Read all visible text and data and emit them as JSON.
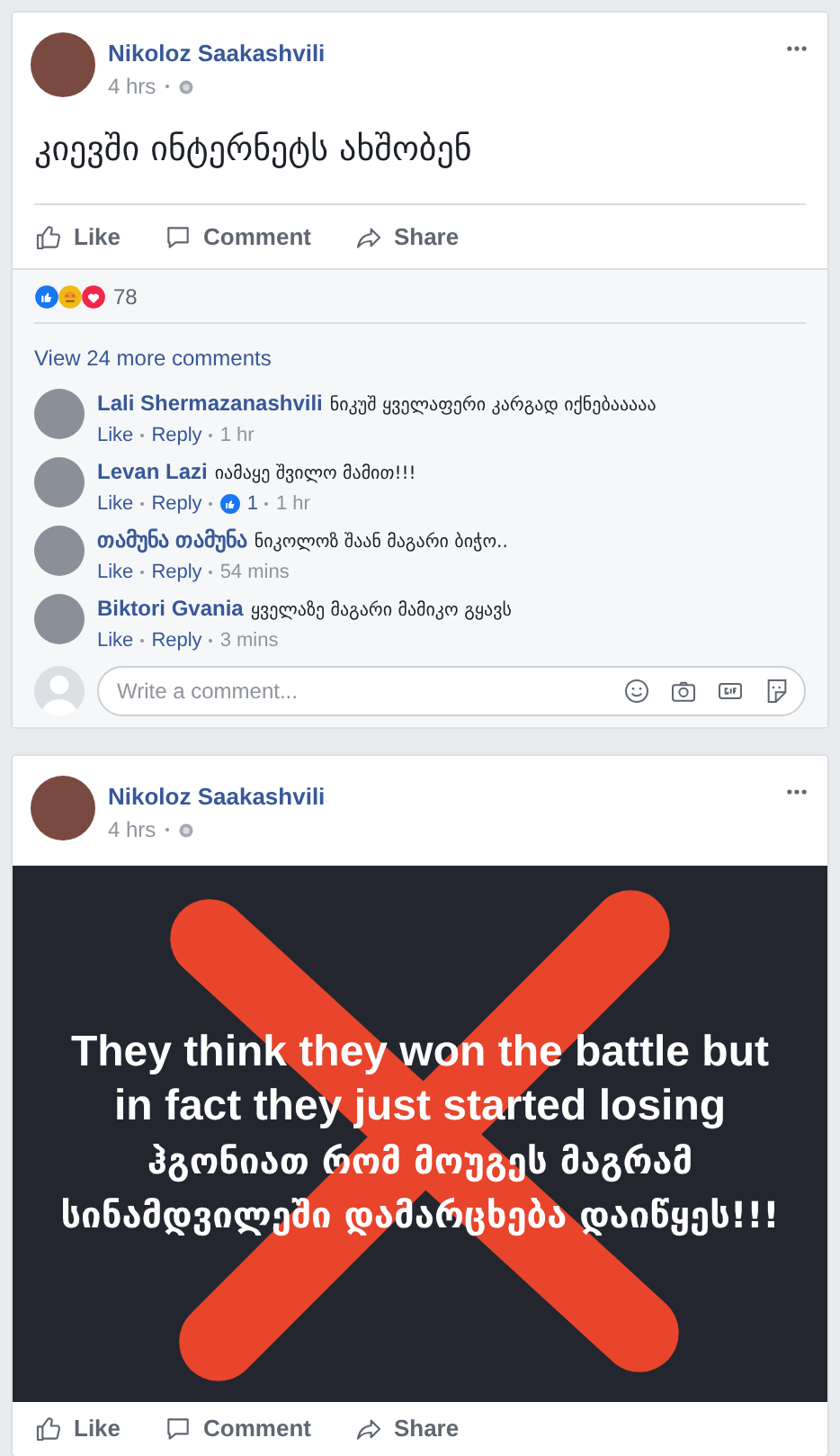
{
  "posts": [
    {
      "author": "Nikoloz Saakashvili",
      "time": "4 hrs",
      "text": "კიევში ინტერნეტს ახშობენ",
      "actions": [
        "Like",
        "Comment",
        "Share"
      ],
      "reactions": {
        "count": "78"
      },
      "view_more": "View 24 more comments",
      "comments": [
        {
          "author": "Lali Shermazanashvili",
          "text": "ნიკუშ ყველაფერი კარგად იქნებააააა",
          "like": "Like",
          "reply": "Reply",
          "time": "1 hr"
        },
        {
          "author": "Levan Lazi",
          "text": "იამაყე შვილო მამით!!!",
          "like": "Like",
          "reply": "Reply",
          "likes": "1",
          "time": "1 hr"
        },
        {
          "author": "თამუნა თამუნა",
          "text": "ნიკოლოზ შაან მაგარი ბიჭო..",
          "like": "Like",
          "reply": "Reply",
          "time": "54 mins"
        },
        {
          "author": "Biktori Gvania",
          "text": "ყველაზე მაგარი მამიკო გყავს",
          "like": "Like",
          "reply": "Reply",
          "time": "3 mins"
        }
      ],
      "comment_box": {
        "placeholder": "Write a comment..."
      }
    },
    {
      "author": "Nikoloz Saakashvili",
      "time": "4 hrs",
      "image": {
        "caption_en": "They think they won the battle but in fact they just started losing",
        "caption_ka": "ჰგონიათ რომ მოუგეს მაგრამ სინამდვილეში დამარცხება დაიწყეს!!!"
      },
      "actions": [
        "Like",
        "Comment",
        "Share"
      ]
    }
  ]
}
